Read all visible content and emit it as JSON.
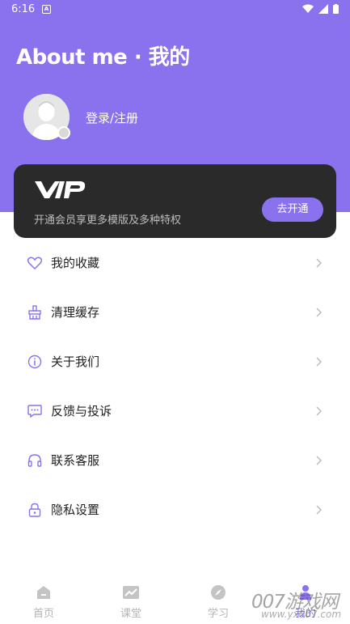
{
  "status_bar": {
    "time": "6:16",
    "notification_icon": "A"
  },
  "header": {
    "title": "About me · 我的"
  },
  "profile": {
    "login_label": "登录/注册"
  },
  "vip": {
    "logo": "VIP",
    "description": "开通会员享更多模版及多种特权",
    "button_label": "去开通"
  },
  "menu": {
    "items": [
      {
        "label": "我的收藏",
        "icon": "heart-icon"
      },
      {
        "label": "清理缓存",
        "icon": "broom-icon"
      },
      {
        "label": "关于我们",
        "icon": "info-icon"
      },
      {
        "label": "反馈与投诉",
        "icon": "message-icon"
      },
      {
        "label": "联系客服",
        "icon": "headset-icon"
      },
      {
        "label": "隐私设置",
        "icon": "lock-icon"
      }
    ]
  },
  "bottom_nav": {
    "tabs": [
      {
        "label": "首页",
        "icon": "home-icon"
      },
      {
        "label": "课堂",
        "icon": "chart-icon"
      },
      {
        "label": "学习",
        "icon": "compass-icon"
      },
      {
        "label": "我的",
        "icon": "person-icon"
      }
    ]
  },
  "watermark": {
    "text": "007游戏网",
    "url": "www.yx007.com"
  },
  "colors": {
    "accent": "#8a72ee",
    "card": "#2a2a2a"
  }
}
